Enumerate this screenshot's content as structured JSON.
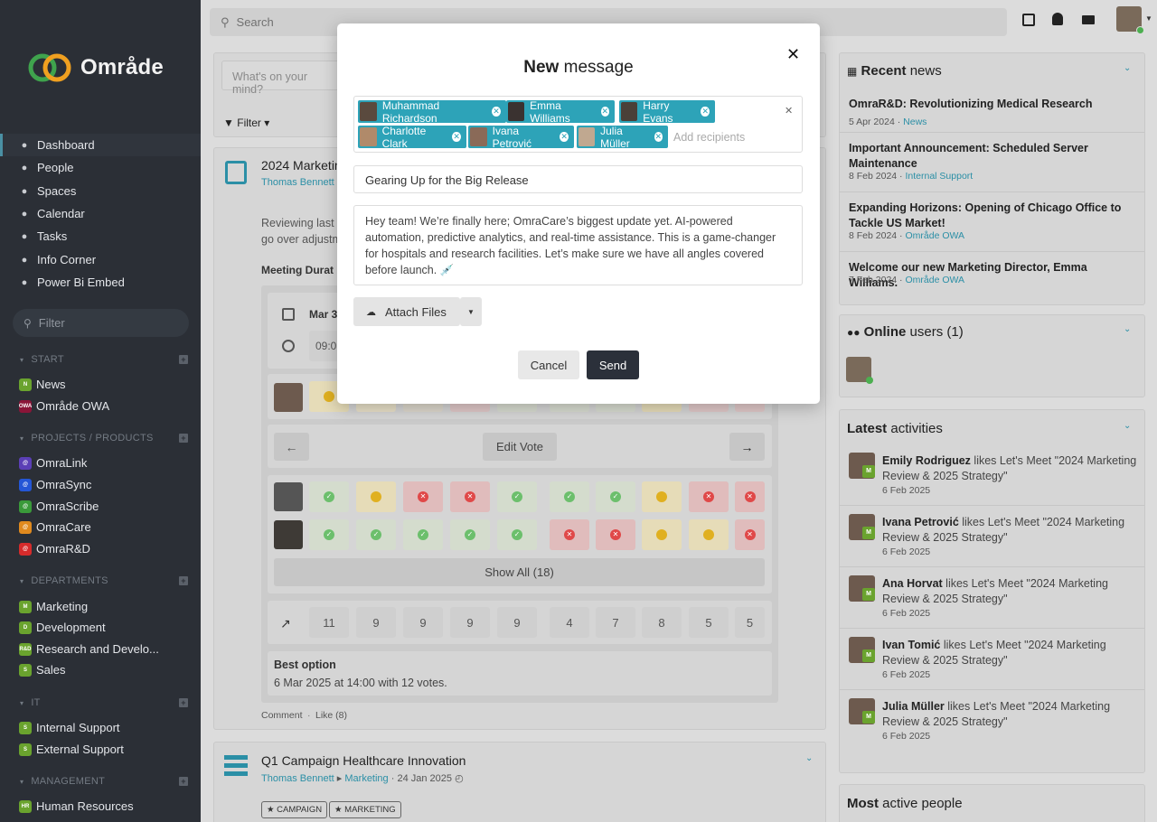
{
  "app": {
    "name": "Område"
  },
  "sidebar": {
    "nav": [
      {
        "label": "Dashboard",
        "icon": "palette-icon"
      },
      {
        "label": "People",
        "icon": "people-icon"
      },
      {
        "label": "Spaces",
        "icon": "spaces-icon"
      },
      {
        "label": "Calendar",
        "icon": "calendar-icon"
      },
      {
        "label": "Tasks",
        "icon": "tasks-icon"
      },
      {
        "label": "Info Corner",
        "icon": "info-icon"
      },
      {
        "label": "Power Bi Embed",
        "icon": "half-circle-icon"
      }
    ],
    "filter_placeholder": "Filter",
    "sections": [
      {
        "title": "START",
        "items": [
          {
            "label": "News",
            "badge": "N",
            "color": "#6aa32e"
          },
          {
            "label": "Område OWA",
            "badge": "OWA",
            "color": "#8a1538"
          }
        ]
      },
      {
        "title": "PROJECTS / PRODUCTS",
        "items": [
          {
            "label": "OmraLink",
            "badge": "@",
            "color": "#5b3fb6"
          },
          {
            "label": "OmraSync",
            "badge": "@",
            "color": "#2456d6"
          },
          {
            "label": "OmraScribe",
            "badge": "@",
            "color": "#3a9a3a"
          },
          {
            "label": "OmraCare",
            "badge": "@",
            "color": "#e08a1e"
          },
          {
            "label": "OmraR&D",
            "badge": "@",
            "color": "#d62b2b"
          }
        ]
      },
      {
        "title": "DEPARTMENTS",
        "items": [
          {
            "label": "Marketing",
            "badge": "M",
            "color": "#6aa32e"
          },
          {
            "label": "Development",
            "badge": "D",
            "color": "#6aa32e"
          },
          {
            "label": "Research and Develo...",
            "badge": "R&D",
            "color": "#6aa32e"
          },
          {
            "label": "Sales",
            "badge": "S",
            "color": "#6aa32e"
          }
        ]
      },
      {
        "title": "IT",
        "items": [
          {
            "label": "Internal Support",
            "badge": "S",
            "color": "#6aa32e"
          },
          {
            "label": "External Support",
            "badge": "S",
            "color": "#6aa32e"
          }
        ]
      },
      {
        "title": "MANAGEMENT",
        "items": [
          {
            "label": "Human Resources",
            "badge": "HR",
            "color": "#6aa32e"
          }
        ]
      }
    ]
  },
  "topbar": {
    "search_placeholder": "Search"
  },
  "feed": {
    "post_placeholder": "What's on your mind?",
    "filter_label": "Filter",
    "post1": {
      "title": "2024 Marketin",
      "author": "Thomas Bennett",
      "body_line1": "Reviewing last y",
      "body_line2": "go over adjustm",
      "meeting_label": "Meeting Durat",
      "date_label": "Mar 3",
      "time_label": "09:0",
      "edit_vote": "Edit Vote",
      "show_all": "Show All (18)",
      "counts": [
        "11",
        "9",
        "9",
        "9",
        "9",
        "4",
        "7",
        "8",
        "5",
        "5"
      ],
      "best_option_label": "Best option",
      "best_option_value": "6 Mar 2025 at 14:00 with 12 votes.",
      "comment": "Comment",
      "like": "Like (8)",
      "vote_rows": [
        [
          "yes",
          "maybe",
          "no",
          "no",
          "yes",
          "yes",
          "yes",
          "maybe",
          "no",
          "no"
        ],
        [
          "yes",
          "yes",
          "yes",
          "yes",
          "yes",
          "no",
          "no",
          "maybe",
          "maybe",
          "no"
        ]
      ],
      "first_row": [
        "maybe",
        "",
        "",
        "",
        "",
        "",
        "",
        "",
        "",
        ""
      ]
    },
    "post2": {
      "title": "Q1 Campaign Healthcare Innovation",
      "author": "Thomas Bennett",
      "workspace": "Marketing",
      "date": "24 Jan 2025",
      "tags": [
        "CAMPAIGN",
        "MARKETING"
      ]
    }
  },
  "modal": {
    "title_bold": "New",
    "title_rest": " message",
    "recipients": [
      "Muhammad Richardson",
      "Emma Williams",
      "Harry Evans",
      "Charlotte Clark",
      "Ivana Petrović",
      "Julia Müller"
    ],
    "recipients_placeholder": "Add recipients",
    "subject": "Gearing Up for the Big Release",
    "body": "Hey team! We’re finally here; OmraCare’s biggest update yet. AI-powered automation, predictive analytics, and real-time assistance. This is a game-changer for hospitals and research facilities. Let’s make sure we have all angles covered before launch. 💉",
    "attach_label": "Attach Files",
    "cancel_label": "Cancel",
    "send_label": "Send"
  },
  "right": {
    "news_title_bold": "Recent",
    "news_title_rest": " news",
    "news": [
      {
        "title": "OmraR&D: Revolutionizing Medical Research",
        "date": "5 Apr 2024",
        "source": "News"
      },
      {
        "title": "Important Announcement: Scheduled Server Maintenance",
        "date": "8 Feb 2024",
        "source": "Internal Support"
      },
      {
        "title": "Expanding Horizons: Opening of Chicago Office to Tackle US Market!",
        "date": "8 Feb 2024",
        "source": "Område OWA"
      },
      {
        "title": "Welcome our new Marketing Director, Emma Williams.",
        "date": "7 Feb 2024",
        "source": "Område OWA"
      }
    ],
    "online_title_bold": "Online",
    "online_title_rest": " users (1)",
    "activity_title_bold": "Latest",
    "activity_title_rest": " activities",
    "activities": [
      {
        "name": "Emily Rodriguez",
        "text": " likes Let's Meet \"2024 Marketing Review & 2025 Strategy\"",
        "date": "6 Feb 2025"
      },
      {
        "name": "Ivana Petrović",
        "text": " likes Let's Meet \"2024 Marketing Review & 2025 Strategy\"",
        "date": "6 Feb 2025"
      },
      {
        "name": "Ana Horvat",
        "text": " likes Let's Meet \"2024 Marketing Review & 2025 Strategy\"",
        "date": "6 Feb 2025"
      },
      {
        "name": "Ivan Tomić",
        "text": " likes Let's Meet \"2024 Marketing Review & 2025 Strategy\"",
        "date": "6 Feb 2025"
      },
      {
        "name": "Julia Müller",
        "text": " likes Let's Meet \"2024 Marketing Review & 2025 Strategy\"",
        "date": "6 Feb 2025"
      }
    ],
    "people_title_bold": "Most",
    "people_title_rest": " active people"
  }
}
